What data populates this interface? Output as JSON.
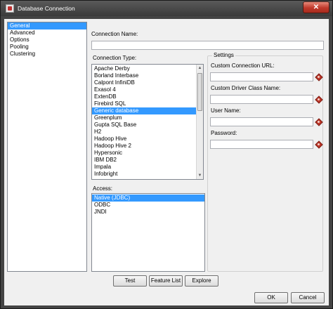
{
  "window": {
    "title": "Database Connection",
    "close_glyph": "✕"
  },
  "nav": {
    "items": [
      {
        "label": "General",
        "selected": true
      },
      {
        "label": "Advanced"
      },
      {
        "label": "Options"
      },
      {
        "label": "Pooling"
      },
      {
        "label": "Clustering"
      }
    ]
  },
  "connection_name": {
    "label": "Connection Name:",
    "value": ""
  },
  "connection_type": {
    "label": "Connection Type:",
    "items": [
      "Apache Derby",
      "Borland Interbase",
      "Calpont InfiniDB",
      "Exasol 4",
      "ExtenDB",
      "Firebird SQL",
      "Generic database",
      "Greenplum",
      "Gupta SQL Base",
      "H2",
      "Hadoop Hive",
      "Hadoop Hive 2",
      "Hypersonic",
      "IBM DB2",
      "Impala",
      "Infobright"
    ],
    "selected": "Generic database"
  },
  "access": {
    "label": "Access:",
    "items": [
      "Native (JDBC)",
      "ODBC",
      "JNDI"
    ],
    "selected": "Native (JDBC)"
  },
  "settings": {
    "title": "Settings",
    "fields": {
      "custom_url": {
        "label": "Custom Connection URL:",
        "value": ""
      },
      "driver_class": {
        "label": "Custom Driver Class Name:",
        "value": ""
      },
      "user_name": {
        "label": "User Name:",
        "value": ""
      },
      "password": {
        "label": "Password:",
        "value": ""
      }
    }
  },
  "buttons": {
    "test": "Test",
    "feature_list": "Feature List",
    "explore": "Explore",
    "ok": "OK",
    "cancel": "Cancel"
  },
  "colors": {
    "selection": "#3399ff",
    "close_button": "#c0392b",
    "variable_icon": "#c0392b"
  },
  "icons": {
    "app": "database-connection-icon",
    "variable": "variable-diamond-icon"
  }
}
